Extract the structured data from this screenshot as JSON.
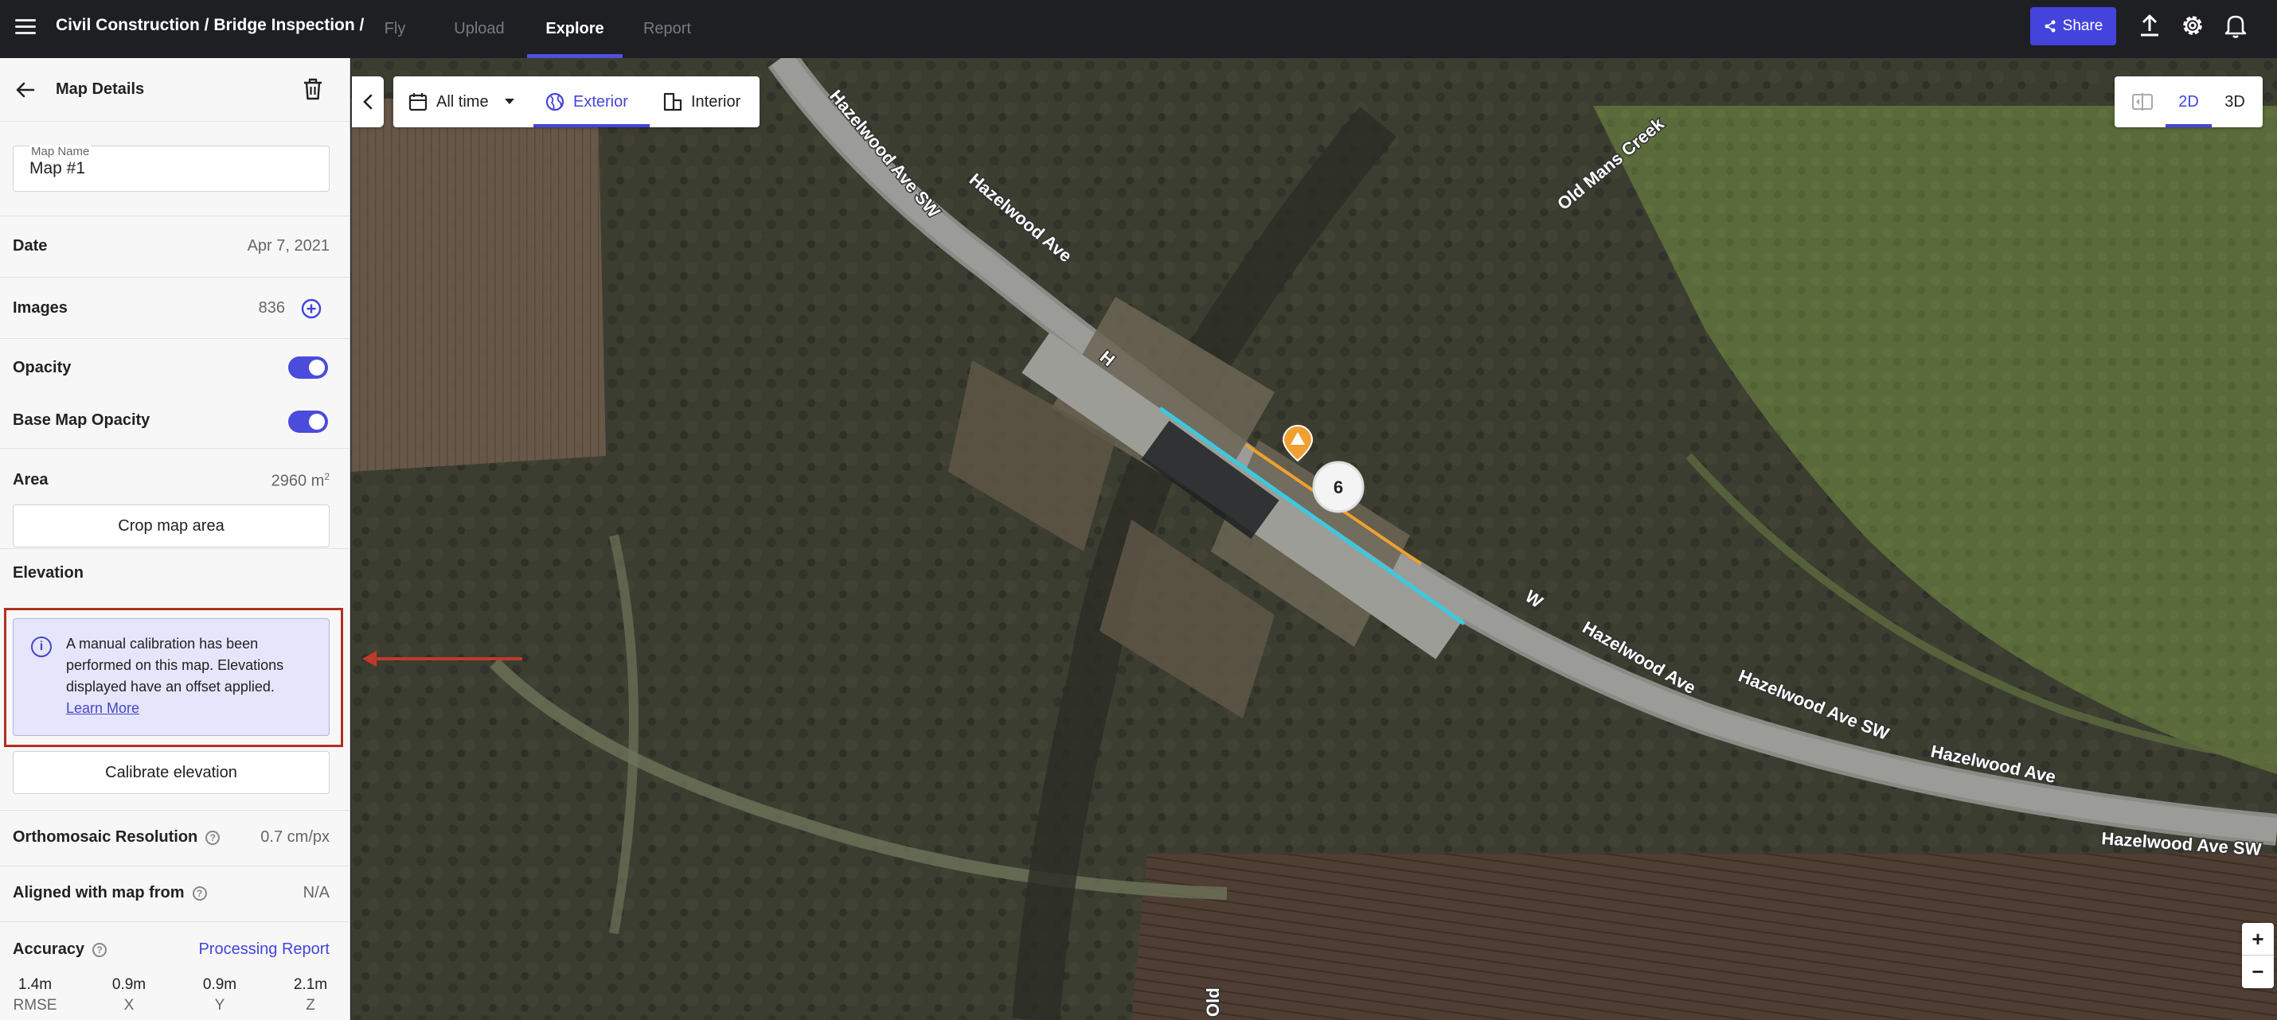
{
  "header": {
    "breadcrumb": "Civil Construction / Bridge Inspection /",
    "nav": [
      {
        "label": "Fly"
      },
      {
        "label": "Upload"
      },
      {
        "label": "Explore"
      },
      {
        "label": "Report"
      }
    ],
    "share_label": "Share",
    "active_tab": "Explore"
  },
  "panel": {
    "title": "Map Details",
    "map_name": {
      "label": "Map Name",
      "value": "Map #1"
    },
    "date": {
      "label": "Date",
      "value": "Apr 7, 2021"
    },
    "images": {
      "label": "Images",
      "value": "836"
    },
    "opacity": {
      "label": "Opacity",
      "on": true
    },
    "base_map_opacity": {
      "label": "Base Map Opacity",
      "on": true
    },
    "area": {
      "label": "Area",
      "value": "2960 m",
      "unit_sup": "2"
    },
    "crop_button": "Crop map area",
    "elevation": {
      "label": "Elevation",
      "notice": "A manual calibration has been performed on this map. Elevations displayed have an offset applied.",
      "learn_more": "Learn More",
      "calibrate_button": "Calibrate elevation"
    },
    "ortho_resolution": {
      "label": "Orthomosaic Resolution",
      "value": "0.7 cm/px"
    },
    "aligned": {
      "label": "Aligned with map from",
      "value": "N/A"
    },
    "accuracy": {
      "label": "Accuracy",
      "report_link": "Processing Report",
      "metrics": [
        {
          "value": "1.4m",
          "label": "RMSE"
        },
        {
          "value": "0.9m",
          "label": "X"
        },
        {
          "value": "0.9m",
          "label": "Y"
        },
        {
          "value": "2.1m",
          "label": "Z"
        }
      ]
    }
  },
  "map": {
    "filter": {
      "time": "All time",
      "exterior": "Exterior",
      "interior": "Interior"
    },
    "view": {
      "mode_2d": "2D",
      "mode_3d": "3D",
      "active": "2D"
    },
    "cluster_count": "6",
    "labels": {
      "creek": "Old Mans Creek",
      "road1": "Hazelwood Ave SW",
      "road2": "Hazelwood Ave",
      "road3": "H",
      "road4": "W",
      "road5": "Hazelwood Ave",
      "road6": "Hazelwood Ave SW",
      "road7": "Hazelwood Ave",
      "road8": "Hazelwood Ave SW",
      "road9": "Old"
    },
    "zoom_in": "+",
    "zoom_out": "−"
  },
  "colors": {
    "accent": "#4444dd",
    "highlight_border": "#b0311c",
    "annotation_arrow": "#c0392b",
    "marker": "#f0a030",
    "measure_line_blue": "#3cc8e0",
    "measure_line_orange": "#f0a030"
  },
  "icons": [
    "menu-icon",
    "share-icon",
    "upload-icon",
    "gear-icon",
    "bell-icon",
    "back-arrow-icon",
    "trash-icon",
    "plus-circle-icon",
    "info-icon",
    "help-icon",
    "calendar-icon",
    "caret-down-icon",
    "globe-icon",
    "building-icon",
    "compare-icon",
    "chevron-left-icon",
    "warning-marker-icon"
  ]
}
